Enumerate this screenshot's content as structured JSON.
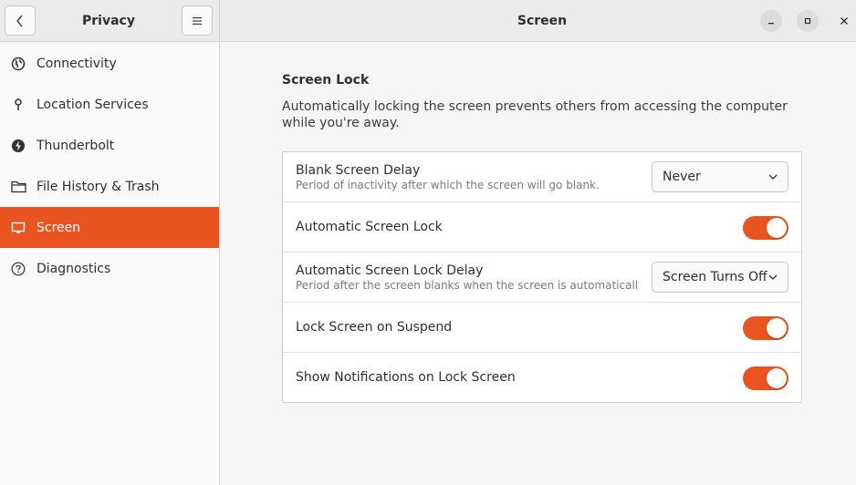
{
  "sidebar_header": {
    "title": "Privacy",
    "back_icon": "back-chevron-icon",
    "menu_icon": "hamburger-menu-icon"
  },
  "main_header": {
    "title": "Screen"
  },
  "sidebar": {
    "items": [
      {
        "label": "Connectivity",
        "icon": "globe-icon",
        "active": false
      },
      {
        "label": "Location Services",
        "icon": "location-pin-icon",
        "active": false
      },
      {
        "label": "Thunderbolt",
        "icon": "thunderbolt-icon",
        "active": false
      },
      {
        "label": "File History & Trash",
        "icon": "folder-icon",
        "active": false
      },
      {
        "label": "Screen",
        "icon": "monitor-icon",
        "active": true
      },
      {
        "label": "Diagnostics",
        "icon": "help-circle-icon",
        "active": false
      }
    ]
  },
  "screen_lock": {
    "title": "Screen Lock",
    "description": "Automatically locking the screen prevents others from accessing the computer while you're away.",
    "rows": [
      {
        "title": "Blank Screen Delay",
        "subtitle": "Period of inactivity after which the screen will go blank.",
        "control": "dropdown",
        "value": "Never"
      },
      {
        "title": "Automatic Screen Lock",
        "control": "toggle",
        "enabled": true
      },
      {
        "title": "Automatic Screen Lock Delay",
        "subtitle": "Period after the screen blanks when the screen is automatically lo...",
        "control": "dropdown",
        "value": "Screen Turns Off"
      },
      {
        "title": "Lock Screen on Suspend",
        "control": "toggle",
        "enabled": true
      },
      {
        "title": "Show Notifications on Lock Screen",
        "control": "toggle",
        "enabled": true
      }
    ]
  },
  "colors": {
    "accent": "#e95420",
    "header_bg": "#ebebeb",
    "sidebar_bg": "#fafafa",
    "content_bg": "#f6f5f4"
  }
}
